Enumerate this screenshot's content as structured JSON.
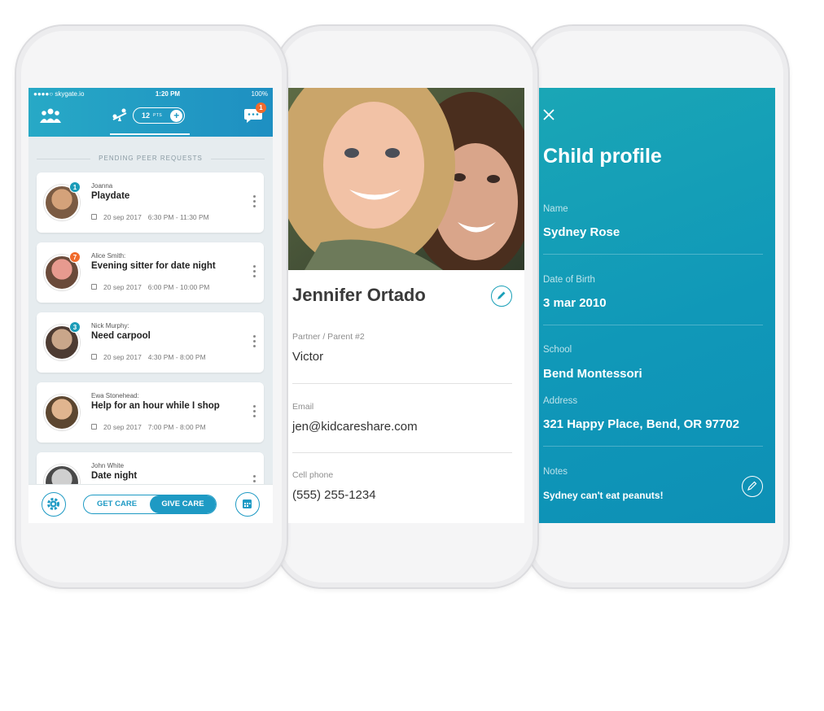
{
  "colors": {
    "accent": "#1e9ac4",
    "teal": "#1aa6b6",
    "badge_orange": "#f06a2b",
    "badge_teal": "#1a9cb8"
  },
  "screen1": {
    "status": {
      "carrier": "●●●●○ skygate.io",
      "time": "1:20 PM",
      "battery": "100%"
    },
    "nav": {
      "points": "12",
      "points_unit": "PTS",
      "chat_badge": "1"
    },
    "section_title": "PENDING PEER REQUESTS",
    "requests": [
      {
        "who": "Joanna",
        "what": "Playdate",
        "date": "20 sep 2017",
        "time": "6:30 PM - 11:30 PM",
        "badge": "1",
        "badge_color": "teal"
      },
      {
        "who": "Alice Smith:",
        "what": "Evening sitter for date night",
        "date": "20 sep 2017",
        "time": "6:00 PM - 10:00 PM",
        "badge": "7",
        "badge_color": "orange"
      },
      {
        "who": "Nick Murphy:",
        "what": "Need carpool",
        "date": "20 sep 2017",
        "time": "4:30 PM - 8:00 PM",
        "badge": "3",
        "badge_color": "teal"
      },
      {
        "who": "Ewa Stonehead:",
        "what": "Help for an hour while I shop",
        "date": "20 sep 2017",
        "time": "7:00 PM - 8:00 PM",
        "badge": "",
        "badge_color": ""
      },
      {
        "who": "John White",
        "what": "Date night",
        "date": "",
        "time": "",
        "badge": "",
        "badge_color": ""
      }
    ],
    "bottom": {
      "get_care": "GET CARE",
      "give_care": "GIVE CARE"
    }
  },
  "screen2": {
    "name": "Jennifer Ortado",
    "fields": [
      {
        "label": "Partner / Parent #2",
        "value": "Victor"
      },
      {
        "label": "Email",
        "value": "jen@kidcareshare.com"
      },
      {
        "label": "Cell phone",
        "value": "(555) 255-1234"
      }
    ]
  },
  "screen3": {
    "title": "Child profile",
    "fields": [
      {
        "label": "Name",
        "value": "Sydney Rose"
      },
      {
        "label": "Date of Birth",
        "value": "3 mar 2010"
      },
      {
        "label": "School",
        "value": "Bend Montessori"
      },
      {
        "label": "Address",
        "value": "321 Happy Place, Bend, OR 97702"
      },
      {
        "label": "Notes",
        "value": "Sydney can't eat peanuts!"
      }
    ]
  }
}
